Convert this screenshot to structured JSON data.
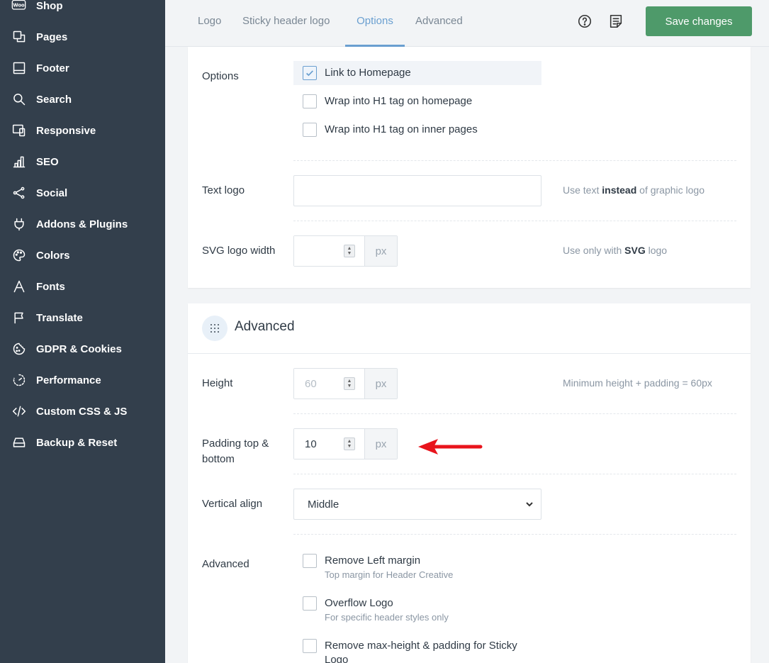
{
  "sidebar": {
    "items": [
      {
        "label": "Shop",
        "icon": "woo-icon"
      },
      {
        "label": "Pages",
        "icon": "pages-icon"
      },
      {
        "label": "Footer",
        "icon": "footer-icon"
      },
      {
        "label": "Search",
        "icon": "search-icon"
      },
      {
        "label": "Responsive",
        "icon": "responsive-icon"
      },
      {
        "label": "SEO",
        "icon": "seo-icon"
      },
      {
        "label": "Social",
        "icon": "share-icon"
      },
      {
        "label": "Addons & Plugins",
        "icon": "plug-icon"
      },
      {
        "label": "Colors",
        "icon": "palette-icon"
      },
      {
        "label": "Fonts",
        "icon": "font-icon"
      },
      {
        "label": "Translate",
        "icon": "flag-icon"
      },
      {
        "label": "GDPR & Cookies",
        "icon": "cookie-icon"
      },
      {
        "label": "Performance",
        "icon": "performance-icon"
      },
      {
        "label": "Custom CSS & JS",
        "icon": "code-icon"
      },
      {
        "label": "Backup & Reset",
        "icon": "backup-icon"
      }
    ],
    "woo_badge": "Woo"
  },
  "tabs": [
    {
      "label": "Logo"
    },
    {
      "label": "Sticky header logo"
    },
    {
      "label": "Options",
      "active": true
    },
    {
      "label": "Advanced"
    }
  ],
  "toolbar": {
    "help_icon": "help-circle-icon",
    "notes_icon": "notes-icon",
    "save_label": "Save changes"
  },
  "options": {
    "label": "Options",
    "checkboxes": [
      {
        "label": "Link to Homepage",
        "checked": true
      },
      {
        "label": "Wrap into H1 tag on homepage",
        "checked": false
      },
      {
        "label": "Wrap into H1 tag on inner pages",
        "checked": false
      }
    ]
  },
  "text_logo": {
    "label": "Text logo",
    "value": "",
    "desc_pre": "Use text ",
    "desc_bold": "instead",
    "desc_post": " of graphic logo"
  },
  "svg_width": {
    "label": "SVG logo width",
    "value": "",
    "unit": "px",
    "desc_pre": "Use only with ",
    "desc_bold": "SVG",
    "desc_post": " logo"
  },
  "advanced_section": {
    "title": "Advanced",
    "icon": "grid-dots-icon"
  },
  "height": {
    "label": "Height",
    "value": "60",
    "unit": "px",
    "desc": "Minimum height + padding = 60px"
  },
  "padding": {
    "label": "Padding top & bottom",
    "value": "10",
    "unit": "px"
  },
  "vertical_align": {
    "label": "Vertical align",
    "value": "Middle"
  },
  "advanced": {
    "label": "Advanced",
    "checkboxes": [
      {
        "label": "Remove Left margin",
        "sub": "Top margin for Header Creative",
        "checked": false
      },
      {
        "label": "Overflow Logo",
        "sub": "For specific header styles only",
        "checked": false
      },
      {
        "label": "Remove max-height & padding for Sticky Logo",
        "sub": "",
        "checked": false
      }
    ]
  },
  "colors": {
    "sidebar_bg": "#333f4c",
    "accent": "#6a9fd0",
    "save_bg": "#4e9a6a",
    "arrow": "#e8141c"
  }
}
